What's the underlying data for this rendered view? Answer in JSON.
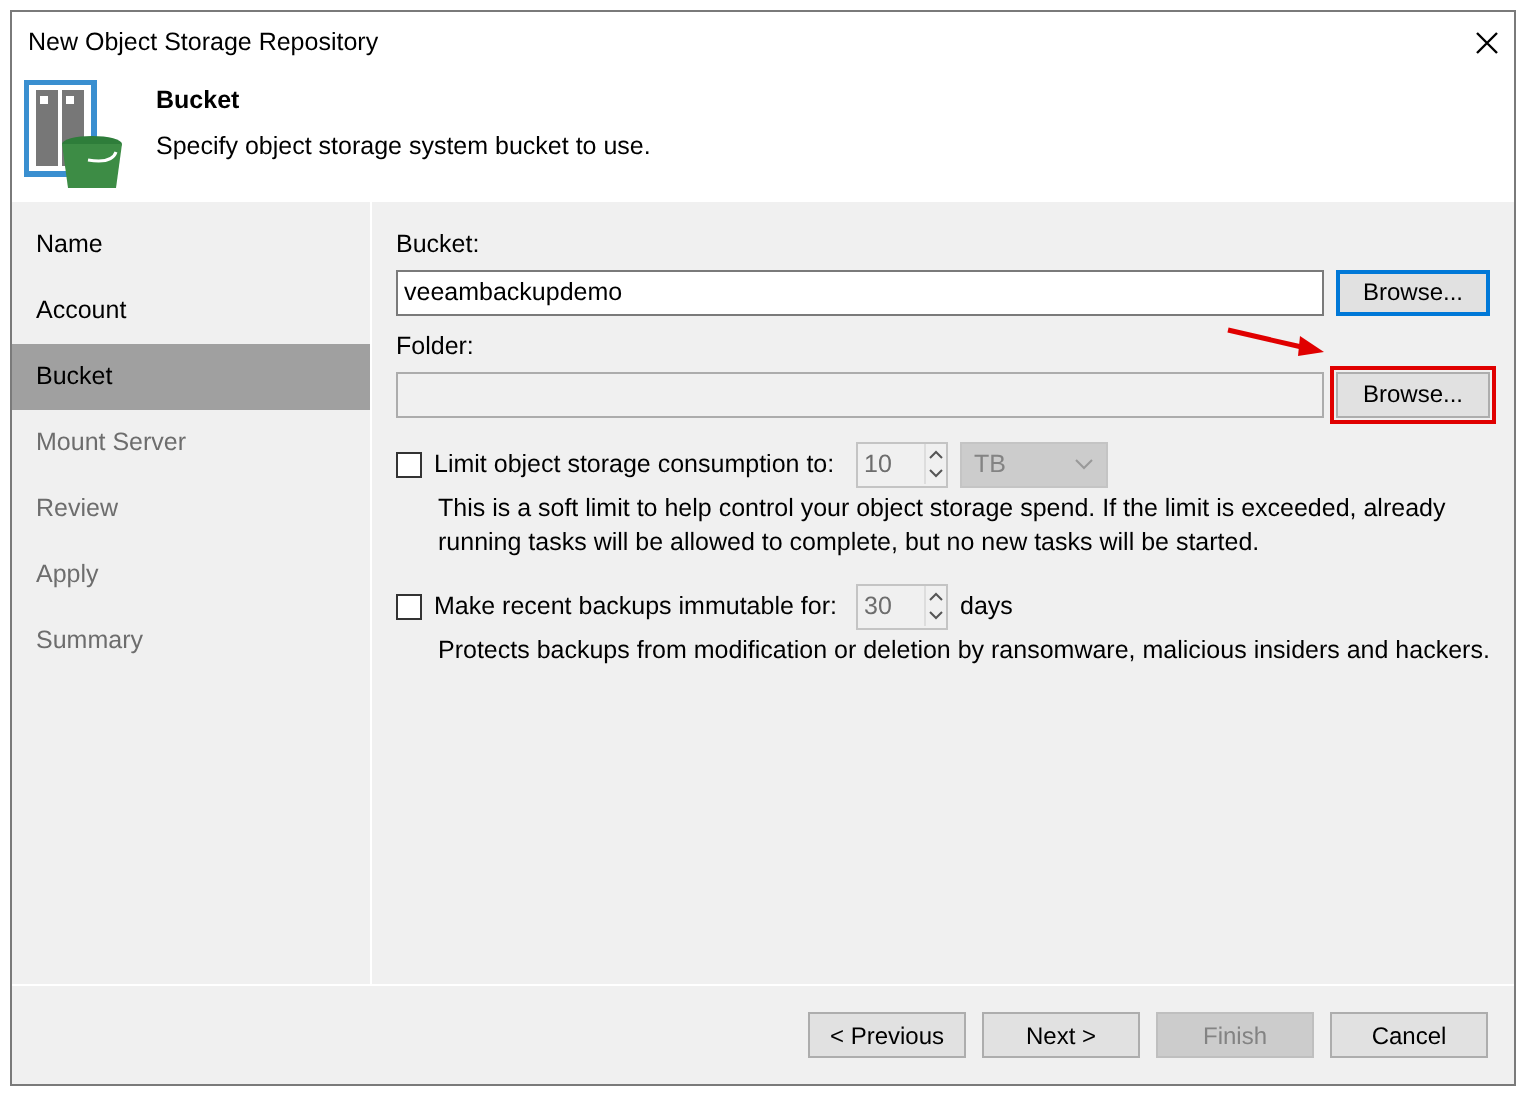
{
  "window": {
    "title": "New Object Storage Repository"
  },
  "header": {
    "title": "Bucket",
    "subtitle": "Specify object storage system bucket to use."
  },
  "steps": [
    {
      "label": "Name",
      "selected": false,
      "disabled": false
    },
    {
      "label": "Account",
      "selected": false,
      "disabled": false
    },
    {
      "label": "Bucket",
      "selected": true,
      "disabled": false
    },
    {
      "label": "Mount Server",
      "selected": false,
      "disabled": true
    },
    {
      "label": "Review",
      "selected": false,
      "disabled": true
    },
    {
      "label": "Apply",
      "selected": false,
      "disabled": true
    },
    {
      "label": "Summary",
      "selected": false,
      "disabled": true
    }
  ],
  "fields": [
    {
      "label": "Bucket:",
      "value": "veeambackupdemo",
      "button": "Browse...",
      "focused": true,
      "highlighted": false
    },
    {
      "label": "Folder:",
      "button": "Browse...",
      "focused": false,
      "highlighted": true
    }
  ],
  "options": [
    {
      "label": "Limit object storage consumption to:",
      "checked": false,
      "number": "10",
      "unit": "TB",
      "description": "This is a soft limit to help control your object storage spend. If the limit is exceeded, already running tasks will be allowed to complete, but no new tasks will be started."
    },
    {
      "label": "Make recent backups immutable for:",
      "checked": false,
      "number": "30",
      "suffix": "days",
      "description": "Protects backups from modification or deletion by ransomware, malicious insiders and hackers."
    }
  ],
  "buttons": [
    {
      "label": "< Previous",
      "disabled": false
    },
    {
      "label": "Next >",
      "disabled": false
    },
    {
      "label": "Finish",
      "disabled": true
    },
    {
      "label": "Cancel",
      "disabled": false
    }
  ]
}
